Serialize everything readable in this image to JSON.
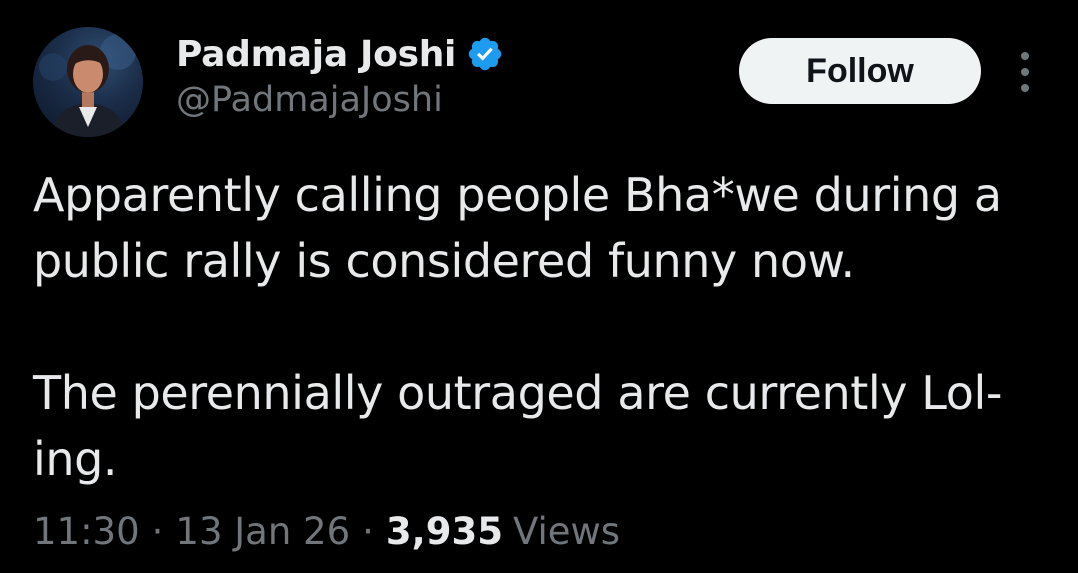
{
  "author": {
    "display_name": "Padmaja Joshi",
    "handle": "@PadmajaJoshi",
    "verified": true,
    "verified_color": "#1d9bf0",
    "avatar_icon": "profile-photo"
  },
  "actions": {
    "follow_label": "Follow",
    "more_icon": "vertical-ellipsis-icon"
  },
  "tweet": {
    "paragraphs": [
      "Apparently calling people Bha*we during a public rally is considered funny now.",
      "The perennially outraged are currently Lol-ing."
    ]
  },
  "meta": {
    "time": "11:30",
    "separator": "·",
    "date": "13 Jan 26",
    "views_count": "3,935",
    "views_label": "Views"
  },
  "colors": {
    "background": "#000000",
    "primary_text": "#e7e9ea",
    "secondary_text": "#71767b",
    "follow_bg": "#eff3f4",
    "follow_text": "#0f1419"
  }
}
